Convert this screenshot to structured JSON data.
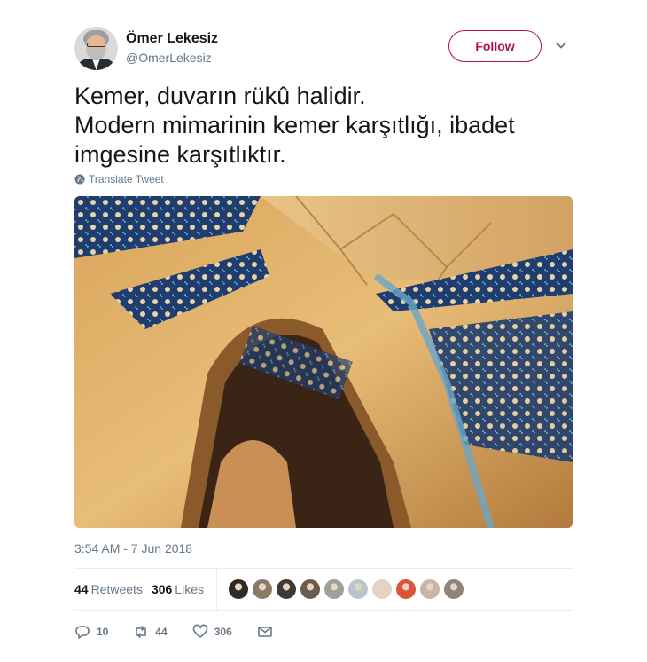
{
  "user": {
    "display_name": "Ömer Lekesiz",
    "handle": "@OmerLekesiz"
  },
  "follow_label": "Follow",
  "tweet": {
    "lines": [
      "Kemer, duvarın rükû halidir.",
      "Modern mimarinin kemer karşıtlığı, ibadet",
      "imgesine karşıtlıktır."
    ],
    "translate_label": "Translate Tweet",
    "timestamp": "3:54 AM - 7 Jun 2018"
  },
  "stats": {
    "retweets_count": "44",
    "retweets_label": "Retweets",
    "likes_count": "306",
    "likes_label": "Likes"
  },
  "actions": {
    "replies": "10",
    "retweets": "44",
    "likes": "306"
  },
  "likers": [
    {
      "color": "#2b2b2b"
    },
    {
      "color": "#8a7a66"
    },
    {
      "color": "#3a3a3a"
    },
    {
      "color": "#6e5b4c"
    },
    {
      "color": "#9aa29a"
    },
    {
      "color": "#b9c4cc"
    },
    {
      "color": "#e6d2c4"
    },
    {
      "color": "#d8553a"
    },
    {
      "color": "#c9b5a8"
    },
    {
      "color": "#8e8478"
    }
  ],
  "colors": {
    "accent": "#b3123b",
    "secondary_text": "#657786",
    "primary_text": "#14171a"
  }
}
